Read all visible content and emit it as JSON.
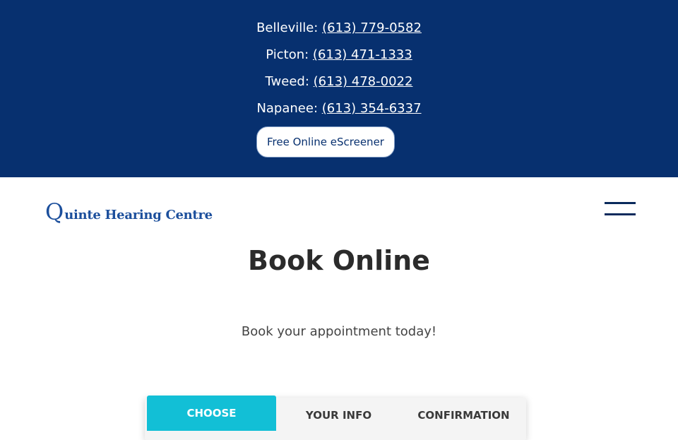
{
  "locations": [
    {
      "name": "Belleville:",
      "phone": "(613) 779-0582"
    },
    {
      "name": "Picton:",
      "phone": "(613) 471-1333"
    },
    {
      "name": "Tweed:",
      "phone": "(613) 478-0022"
    },
    {
      "name": "Napanee:",
      "phone": "(613) 354-6337"
    }
  ],
  "escreener_label": "Free Online eScreener",
  "logo": {
    "initial": "Q",
    "rest": "uinte Hearing Centre"
  },
  "page": {
    "title": "Book Online",
    "subtitle": "Book your appointment today!"
  },
  "steps": [
    {
      "label": "CHOOSE",
      "active": true
    },
    {
      "label": "YOUR INFO",
      "active": false
    },
    {
      "label": "CONFIRMATION",
      "active": false
    }
  ],
  "colors": {
    "topbar": "#07306f",
    "accent": "#12bfd6",
    "brand": "#1c4f9c"
  }
}
